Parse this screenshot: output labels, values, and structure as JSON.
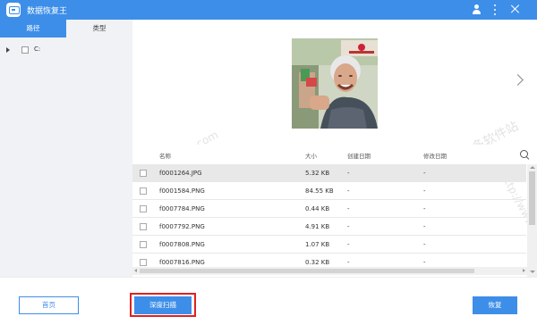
{
  "app": {
    "title": "数据恢复王"
  },
  "tabs": [
    {
      "label": "路径"
    },
    {
      "label": "类型"
    }
  ],
  "tree": {
    "drive_label": "C:"
  },
  "table": {
    "headers": {
      "name": "名称",
      "size": "大小",
      "created": "创建日期",
      "modified": "修改日期"
    },
    "rows": [
      {
        "name": "f0001264.JPG",
        "size": "5.32 KB",
        "created": "-",
        "modified": "-"
      },
      {
        "name": "f0001584.PNG",
        "size": "84.55 KB",
        "created": "-",
        "modified": "-"
      },
      {
        "name": "f0007784.PNG",
        "size": "0.44 KB",
        "created": "-",
        "modified": "-"
      },
      {
        "name": "f0007792.PNG",
        "size": "4.91 KB",
        "created": "-",
        "modified": "-"
      },
      {
        "name": "f0007808.PNG",
        "size": "1.07 KB",
        "created": "-",
        "modified": "-"
      },
      {
        "name": "f0007816.PNG",
        "size": "0.32 KB",
        "created": "-",
        "modified": "-"
      }
    ]
  },
  "footer": {
    "home_label": "首页",
    "deep_scan_label": "深度扫描",
    "recover_label": "恢复"
  },
  "watermark": {
    "text_1": "多多软件站",
    "text_2": "www.ddooo.com",
    "text_3": "http://www."
  },
  "colors": {
    "accent": "#3d8ee8",
    "highlight_outline": "#e02020",
    "sidebar_bg": "#f0f2f5"
  },
  "icons": [
    "app-logo-icon",
    "user-icon",
    "kebab-menu-icon",
    "close-icon",
    "expand-arrow-icon",
    "next-arrow-icon",
    "search-icon"
  ]
}
